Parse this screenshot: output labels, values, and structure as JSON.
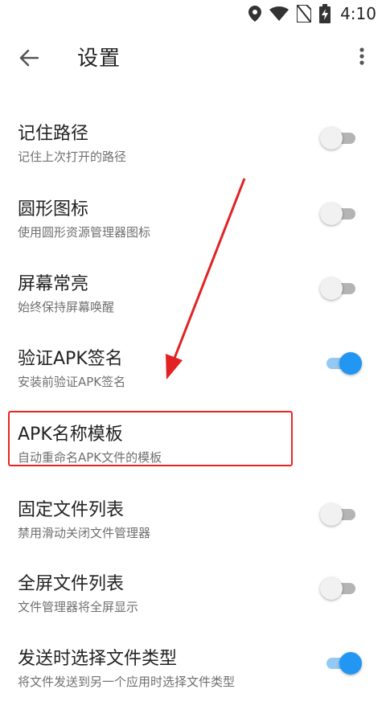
{
  "status_bar": {
    "time": "4:10",
    "icons": [
      "location-icon",
      "wifi-icon",
      "no-sim-icon",
      "battery-charging-icon"
    ]
  },
  "app_bar": {
    "title": "设置",
    "back_icon": "arrow-back-icon",
    "menu_icon": "more-vert-icon"
  },
  "settings": [
    {
      "title": "记住路径",
      "subtitle": "记住上次打开的路径",
      "switch": "off"
    },
    {
      "title": "圆形图标",
      "subtitle": "使用圆形资源管理器图标",
      "switch": "off"
    },
    {
      "title": "屏幕常亮",
      "subtitle": "始终保持屏幕唤醒",
      "switch": "off"
    },
    {
      "title": "验证APK签名",
      "subtitle": "安装前验证APK签名",
      "switch": "on"
    },
    {
      "title": "APK名称模板",
      "subtitle": "自动重命名APK文件的模板",
      "switch": "none",
      "highlighted": true
    },
    {
      "title": "固定文件列表",
      "subtitle": "禁用滑动关闭文件管理器",
      "switch": "off"
    },
    {
      "title": "全屏文件列表",
      "subtitle": "文件管理器将全屏显示",
      "switch": "off"
    },
    {
      "title": "发送时选择文件类型",
      "subtitle": "将文件发送到另一个应用时选择文件类型",
      "switch": "on"
    }
  ],
  "colors": {
    "accent": "#2196f3",
    "annotation": "#e22222"
  }
}
